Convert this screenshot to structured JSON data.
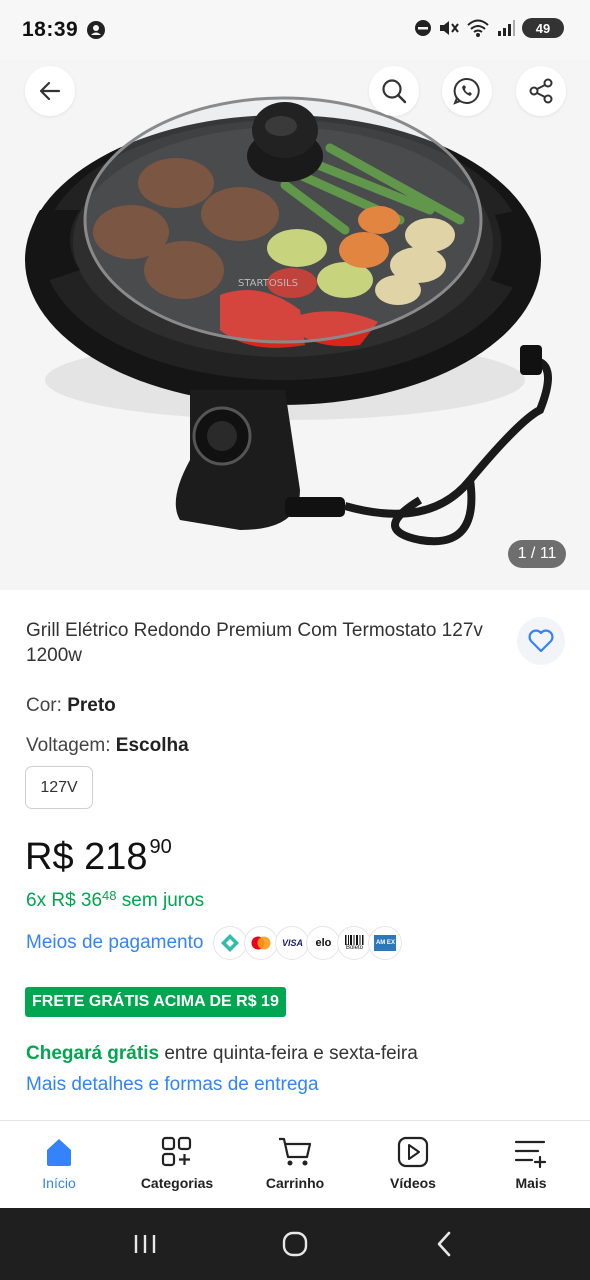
{
  "status_bar": {
    "time": "18:39",
    "battery": "49"
  },
  "gallery": {
    "counter": "1 / 11"
  },
  "product": {
    "title": "Grill Elétrico Redondo Premium Com Termostato 127v 1200w",
    "color_label": "Cor: ",
    "color_value": "Preto",
    "voltage_label": "Voltagem: ",
    "voltage_value": "Escolha",
    "voltage_option": "127V",
    "price_main": "R$ 218",
    "price_cents": "90",
    "installments_prefix": "6x R$ 36",
    "installments_cents": "48",
    "installments_suffix": " sem juros",
    "payment_link": "Meios de pagamento",
    "payment_icons": [
      "pix-icon",
      "mastercard-icon",
      "visa-icon",
      "elo-icon",
      "boleto-icon",
      "amex-icon"
    ],
    "payment_icon_texts": {
      "visa": "VISA",
      "elo": "elo",
      "boleto": "Boleto",
      "amex": "AM EX"
    },
    "free_shipping": "FRETE GRÁTIS ACIMA DE R$ 19",
    "delivery_highlight": "Chegará grátis",
    "delivery_text": " entre quinta-feira e sexta-feira",
    "delivery_link": "Mais detalhes e formas de entrega",
    "image_brand_text": "STARTOSILS"
  },
  "bottom_nav": {
    "items": [
      {
        "label": "Início",
        "icon": "home-icon",
        "active": true
      },
      {
        "label": "Categorias",
        "icon": "categories-icon"
      },
      {
        "label": "Carrinho",
        "icon": "cart-icon"
      },
      {
        "label": "Vídeos",
        "icon": "video-icon"
      },
      {
        "label": "Mais",
        "icon": "more-icon"
      }
    ]
  },
  "colors": {
    "accent_blue": "#3483fa",
    "green": "#00a650",
    "background": "#ffffff"
  }
}
